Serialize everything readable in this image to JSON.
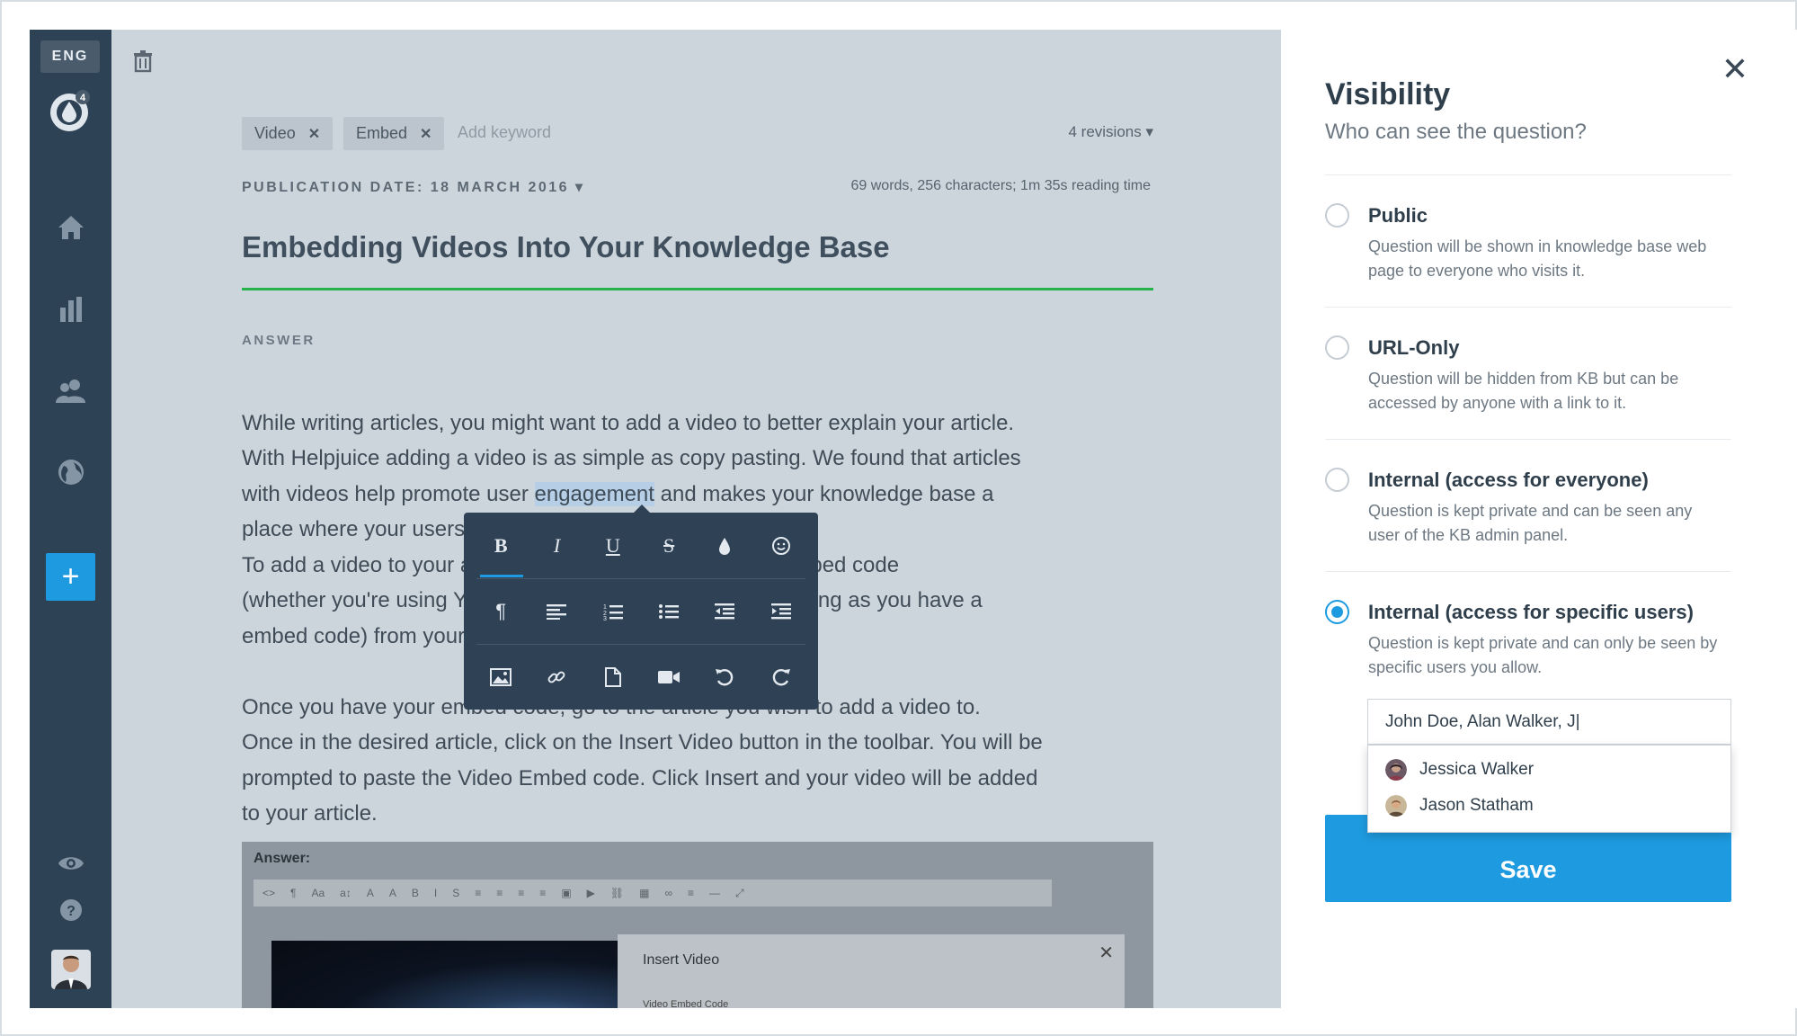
{
  "sidebar": {
    "language": "ENG",
    "logo_badge": "4",
    "add_label": "+"
  },
  "editor": {
    "keywords": [
      {
        "label": "Video",
        "remove": "✕"
      },
      {
        "label": "Embed",
        "remove": "✕"
      }
    ],
    "add_keyword_placeholder": "Add keyword",
    "revisions": "4 revisions ▾",
    "publication_date": "PUBLICATION DATE: 18 MARCH 2016 ▾",
    "stats": "69 words, 256 characters; 1m 35s reading time",
    "title": "Embedding Videos Into Your Knowledge Base",
    "answer_label": "ANSWER",
    "body": {
      "line1": "While writing articles, you might want to add a video to better explain your article.",
      "line2": "With Helpjuice adding a video is as simple as copy pasting. We found that articles",
      "line3_before": "with videos help promote user ",
      "line3_highlight": "engagement",
      "line3_after": " and makes your knowledge base a",
      "line4": "place where your users come to find an answer.",
      "line5": "To add a video to your article, start by copying the video embed code",
      "line6": "(whether you're using YouTube, Vimeo, Wistia or other, as long as you have a",
      "line7": "embed code) from your video provider.",
      "line8": "Once you have your embed code, go to the article you wish to add a video to.",
      "line9": "Once in the desired article, click on the Insert Video button in the toolbar. You will be",
      "line10": "prompted to paste the Video Embed code. Click Insert and your video will be added",
      "line11": "to your article."
    },
    "screenshot": {
      "label": "Answer:",
      "dialog_title": "Insert Video",
      "dialog_close": "✕",
      "dialog_field": "Video Embed Code"
    }
  },
  "toolbar_popup": {
    "row1": [
      "B",
      "I",
      "U",
      "S",
      "color",
      "emoji"
    ],
    "row2": [
      "paragraph",
      "align",
      "ordered-list",
      "unordered-list",
      "outdent",
      "indent"
    ],
    "row3": [
      "image",
      "link",
      "file",
      "video",
      "undo",
      "redo"
    ]
  },
  "panel": {
    "close": "✕",
    "title": "Visibility",
    "subtitle": "Who can see the question?",
    "options": [
      {
        "label": "Public",
        "description": "Question will be shown in knowledge base web page to everyone who visits it.",
        "selected": false
      },
      {
        "label": "URL-Only",
        "description": "Question will be hidden from KB but can be accessed by anyone with a link to it.",
        "selected": false
      },
      {
        "label": "Internal (access for everyone)",
        "description": "Question is kept private and can be seen any user of the KB admin panel.",
        "selected": false
      },
      {
        "label": "Internal (access for specific users)",
        "description": "Question is kept private and can only be seen by specific users you allow.",
        "selected": true
      }
    ],
    "users_input_value": "John Doe, Alan Walker, J|",
    "suggestions": [
      {
        "name": "Jessica Walker"
      },
      {
        "name": "Jason Statham"
      }
    ],
    "save_label": "Save"
  },
  "colors": {
    "sidebar_bg": "#2d4255",
    "accent_blue": "#1e9be0",
    "title_underline": "#28b24b",
    "editor_overlay": "#cdd5dc"
  }
}
